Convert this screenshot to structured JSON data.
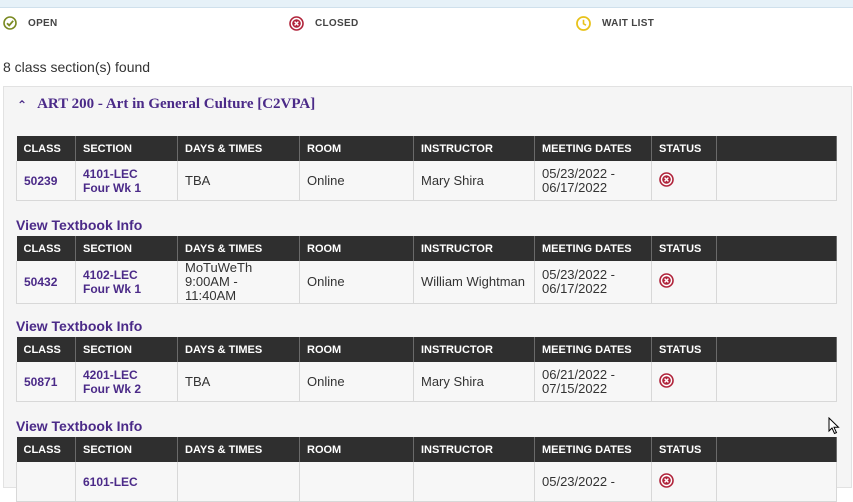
{
  "legend": {
    "open": "OPEN",
    "closed": "CLOSED",
    "waitlist": "WAIT LIST"
  },
  "found_text": "8 class section(s) found",
  "course": {
    "title": "ART 200 - Art in General Culture [C2VPA]"
  },
  "columns": [
    "CLASS",
    "SECTION",
    "DAYS & TIMES",
    "ROOM",
    "INSTRUCTOR",
    "MEETING DATES",
    "STATUS"
  ],
  "textbook_link": "View Textbook Info",
  "sections": [
    {
      "class": "50239",
      "section_line1": "4101-LEC",
      "section_line2": "Four Wk 1",
      "days_line1": "TBA",
      "days_line2": "",
      "room": "Online",
      "instructor": "Mary Shira",
      "dates_line1": "05/23/2022 -",
      "dates_line2": "06/17/2022",
      "status": "closed"
    },
    {
      "class": "50432",
      "section_line1": "4102-LEC",
      "section_line2": "Four Wk 1",
      "days_line1": "MoTuWeTh",
      "days_line2": "9:00AM - 11:40AM",
      "room": "Online",
      "instructor": "William Wightman",
      "dates_line1": "05/23/2022 -",
      "dates_line2": "06/17/2022",
      "status": "closed"
    },
    {
      "class": "50871",
      "section_line1": "4201-LEC",
      "section_line2": "Four Wk 2",
      "days_line1": "TBA",
      "days_line2": "",
      "room": "Online",
      "instructor": "Mary Shira",
      "dates_line1": "06/21/2022 -",
      "dates_line2": "07/15/2022",
      "status": "closed"
    },
    {
      "class": "",
      "section_line1": "6101-LEC",
      "section_line2": "",
      "days_line1": "",
      "days_line2": "",
      "room": "",
      "instructor": "",
      "dates_line1": "05/23/2022 -",
      "dates_line2": "",
      "status": "closed"
    }
  ],
  "colors": {
    "accent_purple": "#4b2a88",
    "header_dark": "#2f2f2f",
    "open_green": "#7a8a22",
    "closed_red": "#b0233a",
    "waitlist_yellow": "#e8c21a"
  }
}
